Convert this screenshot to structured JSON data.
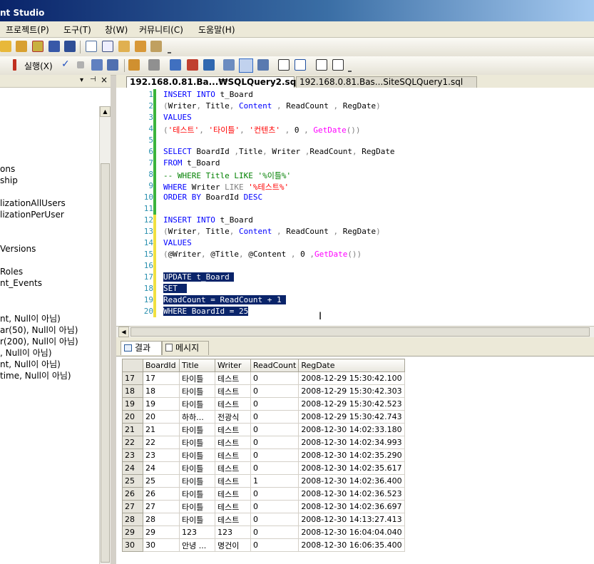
{
  "window": {
    "title": "nt Studio"
  },
  "menu": [
    "프로젝트(P)",
    "도구(T)",
    "창(W)",
    "커뮤니티(C)",
    "도움말(H)"
  ],
  "toolbar2": {
    "execute_label": "실행(X)"
  },
  "left_panel": {
    "items": [
      "ons",
      "ship",
      "lizationAllUsers",
      "lizationPerUser",
      "Versions",
      "Roles",
      "nt_Events",
      "nt, Null이 아님)",
      "ar(50), Null이 아님)",
      "r(200), Null이 아님)",
      ", Null이 아님)",
      "nt, Null이 아님)",
      "time, Null이 아님)"
    ]
  },
  "tabs": [
    {
      "label": "192.168.0.81.Ba...₩SQLQuery2.sql*",
      "active": true
    },
    {
      "label": "192.168.0.81.Bas...SiteSQLQuery1.sql",
      "active": false
    }
  ],
  "editor": {
    "line_numbers": [
      "1",
      "2",
      "3",
      "4",
      "5",
      "6",
      "7",
      "8",
      "9",
      "10",
      "11",
      "12",
      "13",
      "14",
      "15",
      "16",
      "17",
      "18",
      "19",
      "20"
    ],
    "selected_lines": [
      17,
      18,
      19,
      20
    ],
    "line_bars": [
      "green",
      "green",
      "green",
      "green",
      "green",
      "green",
      "green",
      "green",
      "green",
      "green",
      "green",
      "yellow",
      "yellow",
      "yellow",
      "yellow",
      "yellow",
      "yellow",
      "yellow",
      "yellow",
      "yellow"
    ]
  },
  "results": {
    "tab_results": "결과",
    "tab_messages": "메시지",
    "columns": [
      "BoardId",
      "Title",
      "Writer",
      "ReadCount",
      "RegDate"
    ],
    "rows": [
      [
        "17",
        "17",
        "타이틀",
        "테스트",
        "0",
        "2008-12-29 15:30:42.100"
      ],
      [
        "18",
        "18",
        "타이틀",
        "테스트",
        "0",
        "2008-12-29 15:30:42.303"
      ],
      [
        "19",
        "19",
        "타이틀",
        "테스트",
        "0",
        "2008-12-29 15:30:42.523"
      ],
      [
        "20",
        "20",
        "하하...",
        "전광식",
        "0",
        "2008-12-29 15:30:42.743"
      ],
      [
        "21",
        "21",
        "타이틀",
        "테스트",
        "0",
        "2008-12-30 14:02:33.180"
      ],
      [
        "22",
        "22",
        "타이틀",
        "테스트",
        "0",
        "2008-12-30 14:02:34.993"
      ],
      [
        "23",
        "23",
        "타이틀",
        "테스트",
        "0",
        "2008-12-30 14:02:35.290"
      ],
      [
        "24",
        "24",
        "타이틀",
        "테스트",
        "0",
        "2008-12-30 14:02:35.617"
      ],
      [
        "25",
        "25",
        "타이틀",
        "테스트",
        "1",
        "2008-12-30 14:02:36.400"
      ],
      [
        "26",
        "26",
        "타이틀",
        "테스트",
        "0",
        "2008-12-30 14:02:36.523"
      ],
      [
        "27",
        "27",
        "타이틀",
        "테스트",
        "0",
        "2008-12-30 14:02:36.697"
      ],
      [
        "28",
        "28",
        "타이틀",
        "테스트",
        "0",
        "2008-12-30 14:13:27.413"
      ],
      [
        "29",
        "29",
        "123",
        "123",
        "0",
        "2008-12-30 16:04:04.040"
      ],
      [
        "30",
        "30",
        "안녕 ...",
        "명건이",
        "0",
        "2008-12-30 16:06:35.400"
      ]
    ]
  },
  "colors": {
    "keyword": "#0000ff",
    "string": "#ff0000",
    "function": "#ff00ff",
    "comment": "#008000",
    "selection": "#0a246a",
    "titlebar": "#0a246a"
  },
  "icons": [
    "open-folder-icon",
    "save-icon",
    "save-all-icon",
    "execute-icon",
    "check-icon",
    "stop-icon",
    "results-to-grid-icon",
    "comment-icon",
    "uncomment-icon",
    "indent-icon",
    "outdent-icon",
    "results-icon",
    "messages-icon"
  ]
}
